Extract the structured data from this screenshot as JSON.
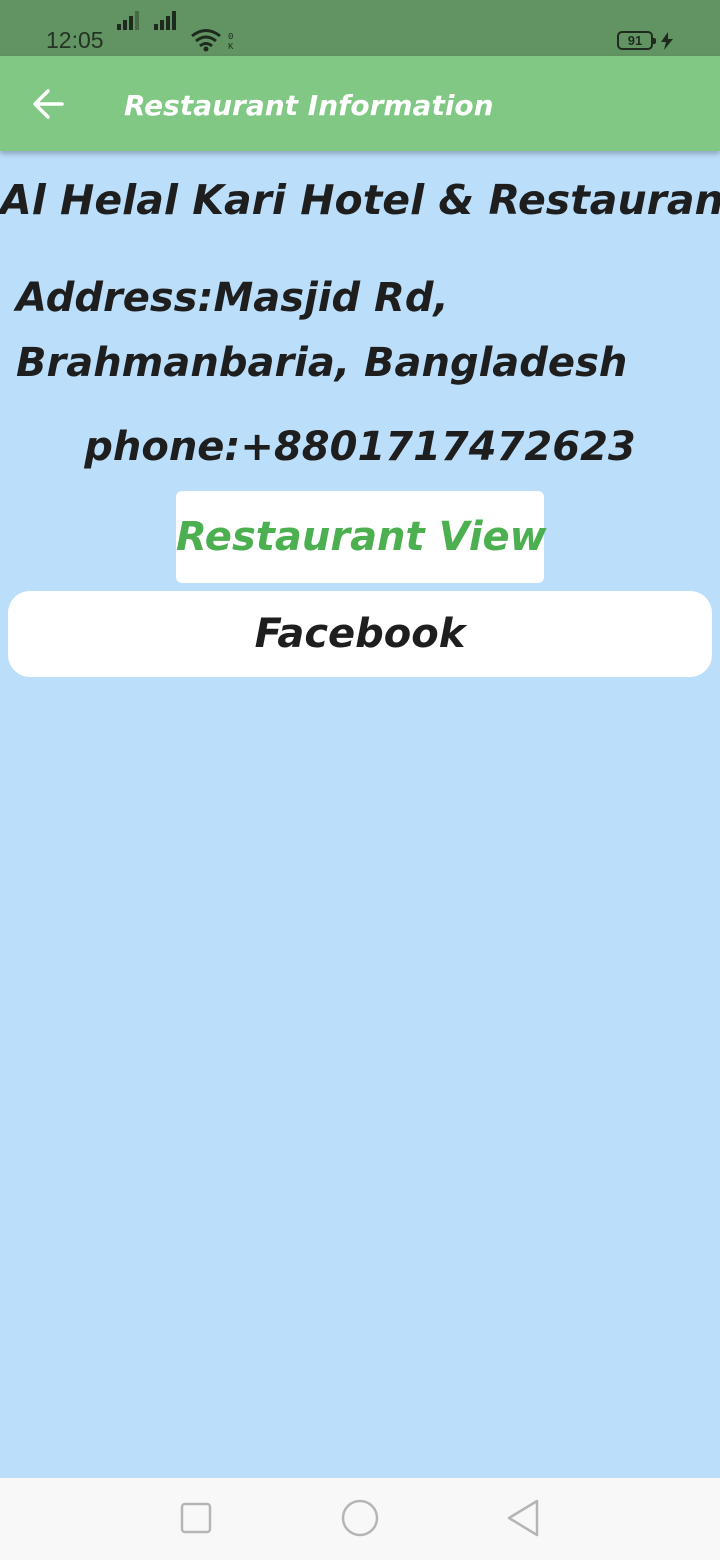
{
  "status_bar": {
    "time": "12:05",
    "ok_label": "0\nK",
    "battery_level": "91",
    "icons": [
      "signal-icon",
      "signal-icon",
      "wifi-icon",
      "charging-icon"
    ]
  },
  "app_bar": {
    "title": "Restaurant Information",
    "back_icon": "arrow-left-icon"
  },
  "restaurant": {
    "name": "Al Helal Kari Hotel & Restaurant",
    "address": "Address:Masjid Rd, Brahmanbaria, Bangladesh",
    "phone": "phone:+8801717472623"
  },
  "buttons": {
    "view_label": "Restaurant View",
    "facebook_label": "Facebook"
  },
  "nav_bar": {
    "icons": [
      "recents-square-icon",
      "home-circle-icon",
      "back-triangle-icon"
    ]
  },
  "colors": {
    "status_bar": "#619462",
    "app_bar": "#81c884",
    "background": "#bbdefa",
    "accent_green": "#4caf50",
    "text": "#1e1e1e"
  }
}
